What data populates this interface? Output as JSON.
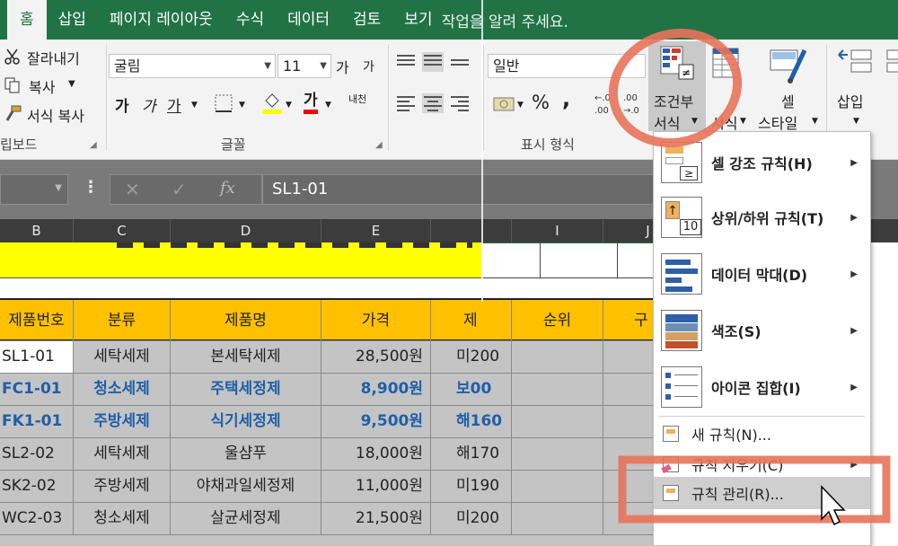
{
  "tabs": [
    "홈",
    "삽입",
    "페이지 레이아웃",
    "수식",
    "데이터",
    "검토",
    "보기"
  ],
  "tell_me": "작업을 알려 주세요.",
  "clipboard": {
    "cut": "잘라내기",
    "copy": "복사",
    "format_painter": "서식 복사",
    "label": "립보드"
  },
  "font": {
    "name": "굴림",
    "size": "11",
    "grow": "가",
    "shrink": "가",
    "bold": "가",
    "italic": "가",
    "underline": "가",
    "phonetic": "내천",
    "label": "글꼴"
  },
  "number": {
    "format": "일반",
    "percent": "%",
    "comma": ",",
    "label": "표시 형식"
  },
  "styles": {
    "cond_format_line1": "조건부",
    "cond_format_line2": "서식",
    "table_format_line2": "서식",
    "cell_styles_line1": "셀",
    "cell_styles_line2": "스타일"
  },
  "cells_group": {
    "insert": "삽입"
  },
  "formula": {
    "content": "SL1-01",
    "fx": "fx"
  },
  "columns": [
    "B",
    "C",
    "D",
    "E",
    "I",
    "J"
  ],
  "header_row": [
    "제품번호",
    "분류",
    "제품명",
    "가격",
    "제",
    "순위",
    "구"
  ],
  "rows": [
    {
      "id": "SL1-01",
      "cat": "세탁세제",
      "name": "본세탁세제",
      "price": "28,500원",
      "mk": "미",
      "num": "200",
      "blue": false
    },
    {
      "id": "FC1-01",
      "cat": "청소세제",
      "name": "주택세정제",
      "price": "8,900원",
      "mk": "보",
      "num": "00",
      "blue": true
    },
    {
      "id": "FK1-01",
      "cat": "주방세제",
      "name": "식기세정제",
      "price": "9,500원",
      "mk": "해",
      "num": "160",
      "blue": true
    },
    {
      "id": "SL2-02",
      "cat": "세탁세제",
      "name": "울샴푸",
      "price": "18,000원",
      "mk": "해",
      "num": "170",
      "blue": false
    },
    {
      "id": "SK2-02",
      "cat": "주방세제",
      "name": "야채과일세정제",
      "price": "11,000원",
      "mk": "미",
      "num": "190",
      "blue": false
    },
    {
      "id": "WC2-03",
      "cat": "청소세제",
      "name": "살균세정제",
      "price": "21,500원",
      "mk": "미",
      "num": "200",
      "blue": false
    }
  ],
  "menu": {
    "highlight": "셀 강조 규칙(H)",
    "topbottom": "상위/하위 규칙(T)",
    "databar": "데이터 막대(D)",
    "colorscale": "색조(S)",
    "iconset": "아이콘 집합(I)",
    "newrule": "새 규칙(N)...",
    "clearrules": "규칙 지우기(C)",
    "managerules": "규칙 관리(R)...",
    "icon_gt": "≥",
    "icon_ten": "10"
  },
  "colors": {
    "accent": "#217346",
    "header_fill": "#ffc000",
    "title_fill": "#ffff00",
    "annotation": "#e8735a",
    "blue_text": "#1f5fa8"
  }
}
